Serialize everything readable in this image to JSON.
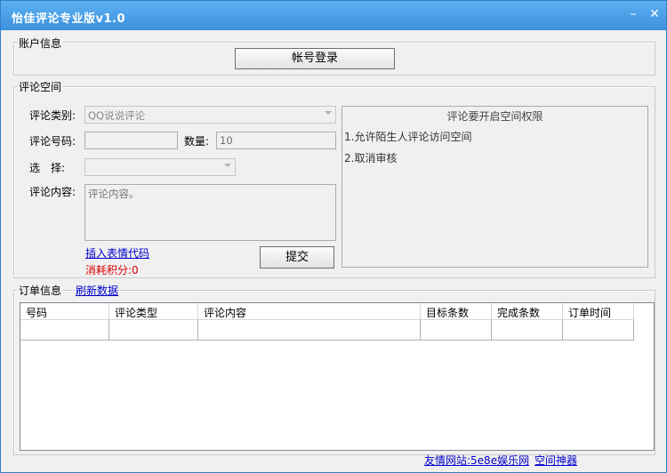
{
  "window": {
    "title": "怡佳评论专业版v1.0",
    "minimize": "–",
    "close": "✕"
  },
  "account": {
    "group_label": "账户信息",
    "login_button": "帐号登录"
  },
  "comment": {
    "group_label": "评论空间",
    "type_label": "评论类别:",
    "type_value": "QQ说说评论",
    "number_label": "评论号码:",
    "number_value": "",
    "quantity_label": "数量:",
    "quantity_value": "10",
    "select_label": "选　择:",
    "select_value": "",
    "content_label": "评论内容:",
    "content_value": "评论内容。",
    "insert_emoji_link": "插入表情代码",
    "cost_label": "消耗积分:0",
    "submit_button": "提交"
  },
  "notice": {
    "title": "评论要开启空间权限",
    "lines": [
      "1.允许陌生人评论访问空间",
      "2.取消审核"
    ]
  },
  "orders": {
    "label": "订单信息",
    "refresh_link": "刷新数据",
    "columns": [
      "号码",
      "评论类型",
      "评论内容",
      "目标条数",
      "完成条数",
      "订单时间"
    ]
  },
  "footer": {
    "friend_link": "友情网站:5e8e娱乐网",
    "space_link": "空间神器"
  }
}
